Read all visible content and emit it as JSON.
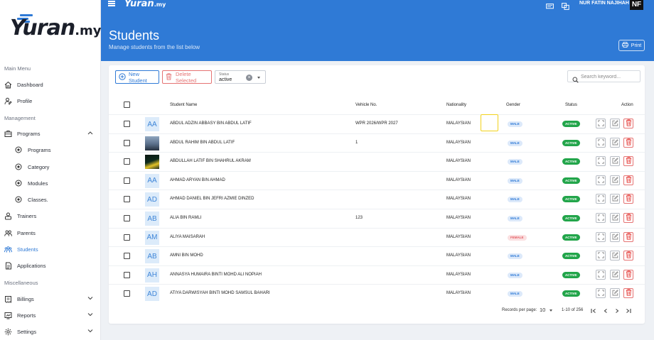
{
  "brand": {
    "logo_text": "Yuran",
    "logo_suffix": ".my"
  },
  "sidebar": {
    "main_menu_label": "Main Menu",
    "management_label": "Management",
    "misc_label": "Miscellaneous",
    "items": {
      "dashboard": "Dashboard",
      "profile": "Profile",
      "programs": "Programs",
      "programs_sub": "Programs",
      "category": "Category",
      "modules": "Modules",
      "classes": "Classes.",
      "trainers": "Trainers",
      "parents": "Parents",
      "students": "Students",
      "applications": "Applications",
      "billings": "Billings",
      "reports": "Reports",
      "settings": "Settings"
    }
  },
  "topbar": {
    "user_name": "NUR FATIN NAJIHAH",
    "user_initials": "NF"
  },
  "page": {
    "title": "Students",
    "subtitle": "Manage students from the list below",
    "print_label": "Print"
  },
  "toolbar": {
    "new_label": "New Student",
    "delete_label": "Delete Selected",
    "status_caption": "Status",
    "status_value": "active",
    "search_placeholder": "Search keyword..."
  },
  "table": {
    "headers": {
      "name": "Student Name",
      "vehicle": "Vehicle No.",
      "nationality": "Nationality",
      "gender": "Gender",
      "status": "Status",
      "action": "Action"
    },
    "rows": [
      {
        "initials": "AA",
        "photo": "",
        "name": "ABDUL ADZIN ABBASY BIN ABDUL LATIF",
        "vehicle": "WPR 2026/WPR 2027",
        "nationality": "MALAYSIAN",
        "gender": "MALE",
        "status": "ACTIVE"
      },
      {
        "initials": "",
        "photo": "photo1",
        "name": "ABDUL RAHIM BIN ABDUL LATIF",
        "vehicle": "1",
        "nationality": "MALAYSIAN",
        "gender": "MALE",
        "status": "ACTIVE"
      },
      {
        "initials": "",
        "photo": "photo2",
        "name": "ABDULLAH LATIF BIN SHAHRUL AKRAM",
        "vehicle": "",
        "nationality": "MALAYSIAN",
        "gender": "MALE",
        "status": "ACTIVE"
      },
      {
        "initials": "AA",
        "photo": "",
        "name": "AHMAD ARYAN BIN AHMAD",
        "vehicle": "",
        "nationality": "MALAYSIAN",
        "gender": "MALE",
        "status": "ACTIVE"
      },
      {
        "initials": "AD",
        "photo": "",
        "name": "AHMAD DANIEL BIN JEFRI AZMIE DINZED",
        "vehicle": "",
        "nationality": "MALAYSIAN",
        "gender": "MALE",
        "status": "ACTIVE"
      },
      {
        "initials": "AB",
        "photo": "",
        "name": "ALIA BIN RAMLI",
        "vehicle": "123",
        "nationality": "MALAYSIAN",
        "gender": "MALE",
        "status": "ACTIVE"
      },
      {
        "initials": "AM",
        "photo": "",
        "name": "ALIYA MAISARAH",
        "vehicle": "",
        "nationality": "MALAYSIAN",
        "gender": "FEMALE",
        "status": "ACTIVE"
      },
      {
        "initials": "AB",
        "photo": "",
        "name": "AMNI BIN MOHD",
        "vehicle": "",
        "nationality": "MALAYSIAN",
        "gender": "MALE",
        "status": "ACTIVE"
      },
      {
        "initials": "AH",
        "photo": "",
        "name": "ANNASYA HUMAIRA BINTI MOHD ALI NOPIAH",
        "vehicle": "",
        "nationality": "MALAYSIAN",
        "gender": "MALE",
        "status": "ACTIVE"
      },
      {
        "initials": "AD",
        "photo": "",
        "name": "ATIYA DARWISYAH BINTI MOHD SAMSUL BAHARI",
        "vehicle": "",
        "nationality": "MALAYSIAN",
        "gender": "MALE",
        "status": "ACTIVE"
      }
    ]
  },
  "pagination": {
    "records_label": "Records per page:",
    "per_page": "10",
    "range": "1-10 of 256"
  },
  "colors": {
    "primary": "#2f7ad6",
    "active_green": "#22a54a",
    "danger": "#e57373",
    "highlight": "#f2d21b"
  },
  "icons": [
    "menu-icon",
    "chat-icon",
    "switch-icon",
    "home-icon",
    "profile-icon",
    "programs-icon",
    "radio-icon",
    "trainers-icon",
    "parents-icon",
    "students-icon",
    "applications-icon",
    "billings-icon",
    "reports-icon",
    "settings-icon",
    "chevron-down-icon",
    "chevron-up-icon",
    "plus-circle-icon",
    "trash-icon",
    "search-icon",
    "print-icon",
    "expand-icon",
    "edit-icon",
    "first-page-icon",
    "prev-page-icon",
    "next-page-icon",
    "last-page-icon"
  ]
}
